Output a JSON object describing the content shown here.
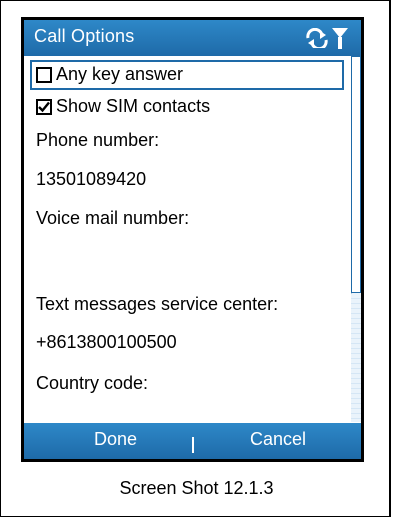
{
  "window": {
    "title": "Call Options"
  },
  "options": {
    "any_key_answer": {
      "label": "Any key answer",
      "checked": false
    },
    "show_sim_contacts": {
      "label": "Show SIM contacts",
      "checked": true
    }
  },
  "fields": [
    {
      "label": "Phone number:",
      "value": "13501089420"
    },
    {
      "label": "Voice mail number:",
      "value": ""
    },
    {
      "label": "Text messages service center:",
      "value": "+8613800100500"
    },
    {
      "label": "Country code:",
      "value": ""
    }
  ],
  "softkeys": {
    "left": "Done",
    "right": "Cancel"
  },
  "caption": "Screen Shot 12.1.3",
  "icons": [
    "sync-icon",
    "signal-icon",
    "checkbox-unchecked-icon",
    "checkmark-icon"
  ],
  "colors": {
    "title_bar": "#1e6aa8",
    "accent": "#1e6aa8"
  }
}
